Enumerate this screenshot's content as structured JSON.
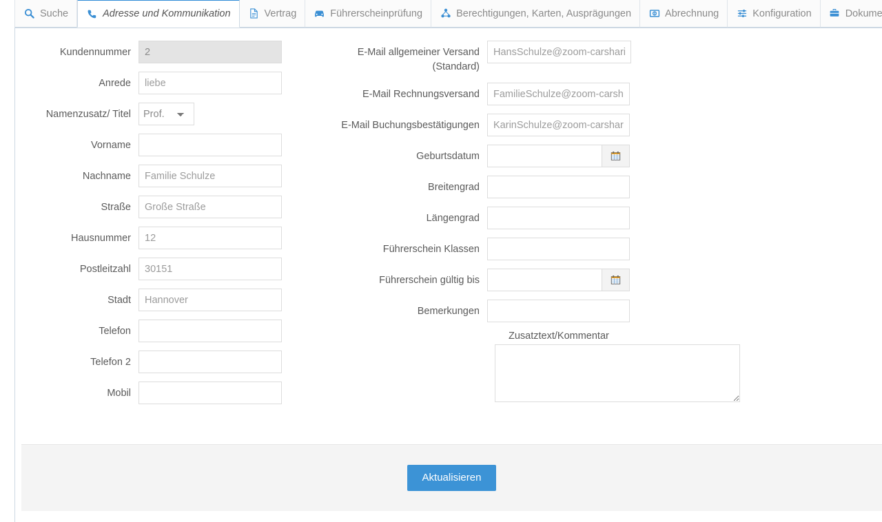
{
  "tabs": [
    {
      "label": "Suche",
      "icon": "search-icon",
      "active": false
    },
    {
      "label": "Adresse und Kommunikation",
      "icon": "phone-icon",
      "active": true
    },
    {
      "label": "Vertrag",
      "icon": "document-icon",
      "active": false
    },
    {
      "label": "Führerscheinprüfung",
      "icon": "car-icon",
      "active": false
    },
    {
      "label": "Berechtigungen, Karten, Ausprägungen",
      "icon": "network-icon",
      "active": false
    },
    {
      "label": "Abrechnung",
      "icon": "money-icon",
      "active": false
    },
    {
      "label": "Konfiguration",
      "icon": "sliders-icon",
      "active": false
    },
    {
      "label": "Dokumente",
      "icon": "briefcase-icon",
      "active": false
    }
  ],
  "form": {
    "left": [
      {
        "label": "Kundennummer",
        "value": "2",
        "placeholder": "",
        "type": "text",
        "disabled": true
      },
      {
        "label": "Anrede",
        "value": "",
        "placeholder": "liebe",
        "type": "text"
      },
      {
        "label": "Namenzusatz/ Titel",
        "value": "Prof.",
        "type": "select",
        "options": [
          "Prof."
        ]
      },
      {
        "label": "Vorname",
        "value": "",
        "placeholder": "",
        "type": "text"
      },
      {
        "label": "Nachname",
        "value": "",
        "placeholder": "Familie Schulze",
        "type": "text"
      },
      {
        "label": "Straße",
        "value": "",
        "placeholder": "Große Straße",
        "type": "text"
      },
      {
        "label": "Hausnummer",
        "value": "",
        "placeholder": "12",
        "type": "text"
      },
      {
        "label": "Postleitzahl",
        "value": "",
        "placeholder": "30151",
        "type": "text"
      },
      {
        "label": "Stadt",
        "value": "",
        "placeholder": "Hannover",
        "type": "text"
      },
      {
        "label": "Telefon",
        "value": "",
        "placeholder": "",
        "type": "text"
      },
      {
        "label": "Telefon 2",
        "value": "",
        "placeholder": "",
        "type": "text"
      },
      {
        "label": "Mobil",
        "value": "",
        "placeholder": "",
        "type": "text"
      }
    ],
    "right": [
      {
        "label": "E-Mail allgemeiner Versand (Standard)",
        "value": "",
        "placeholder": "HansSchulze@zoom-carsharing.de",
        "type": "text"
      },
      {
        "label": "E-Mail Rechnungsversand",
        "value": "",
        "placeholder": "FamilieSchulze@zoom-carsharing.de",
        "type": "text"
      },
      {
        "label": "E-Mail Buchungsbestätigungen",
        "value": "",
        "placeholder": "KarinSchulze@zoom-carsharing.de",
        "type": "text"
      },
      {
        "label": "Geburtsdatum",
        "value": "",
        "placeholder": "",
        "type": "date"
      },
      {
        "label": "Breitengrad",
        "value": "",
        "placeholder": "",
        "type": "text"
      },
      {
        "label": "Längengrad",
        "value": "",
        "placeholder": "",
        "type": "text"
      },
      {
        "label": "Führerschein Klassen",
        "value": "",
        "placeholder": "",
        "type": "text"
      },
      {
        "label": "Führerschein gültig bis",
        "value": "",
        "placeholder": "",
        "type": "date"
      },
      {
        "label": "Bemerkungen",
        "value": "",
        "placeholder": "",
        "type": "text"
      }
    ],
    "comment": {
      "label": "Zusatztext/Kommentar",
      "value": "",
      "placeholder": ""
    }
  },
  "footer": {
    "submit_label": "Aktualisieren"
  },
  "colors": {
    "accent": "#3c93d6",
    "tab_icon": "#3b8fd4",
    "footer_bg": "#f4f4f4",
    "disabled_bg": "#e4e4e4"
  }
}
